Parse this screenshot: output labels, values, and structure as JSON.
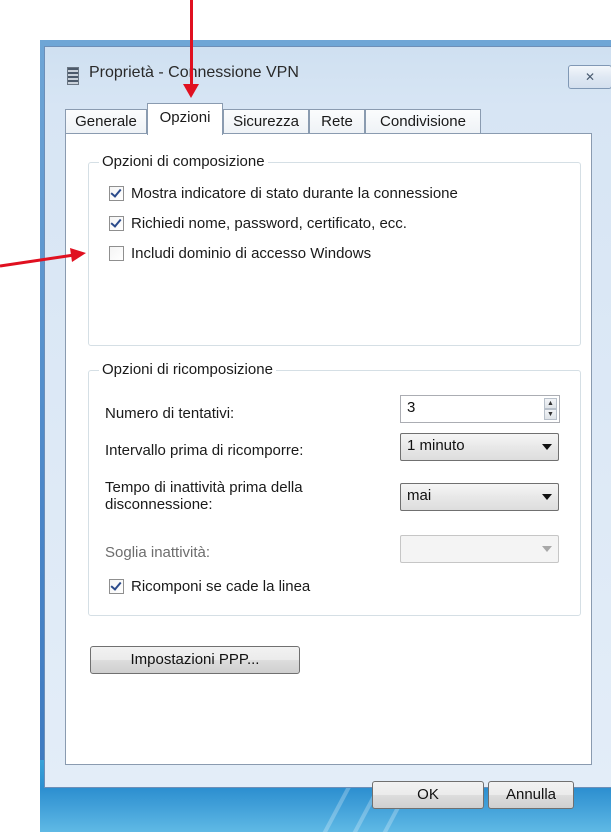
{
  "window": {
    "title": "Proprietà - Connessione VPN",
    "close_label": "✕"
  },
  "tabs": [
    {
      "label": "Generale"
    },
    {
      "label": "Opzioni"
    },
    {
      "label": "Sicurezza"
    },
    {
      "label": "Rete"
    },
    {
      "label": "Condivisione"
    }
  ],
  "active_tab": "Opzioni",
  "dial_options": {
    "title": "Opzioni di composizione",
    "items": [
      {
        "label": "Mostra indicatore di stato durante la connessione",
        "checked": true
      },
      {
        "label": "Richiedi nome, password, certificato, ecc.",
        "checked": true
      },
      {
        "label": "Includi dominio di accesso Windows",
        "checked": false
      }
    ]
  },
  "redial_options": {
    "title": "Opzioni di ricomposizione",
    "attempts_label": "Numero di tentativi:",
    "attempts_value": "3",
    "interval_label": "Intervallo prima di ricomporre:",
    "interval_value": "1 minuto",
    "idle_label": "Tempo di inattività prima della disconnessione:",
    "idle_value": "mai",
    "threshold_label": "Soglia inattività:",
    "threshold_value": "",
    "redial_checkbox": {
      "label": "Ricomponi se cade la linea",
      "checked": true
    }
  },
  "ppp_button_label": "Impostazioni PPP...",
  "ok_label": "OK",
  "cancel_label": "Annulla",
  "annotation_color": "#e01020"
}
